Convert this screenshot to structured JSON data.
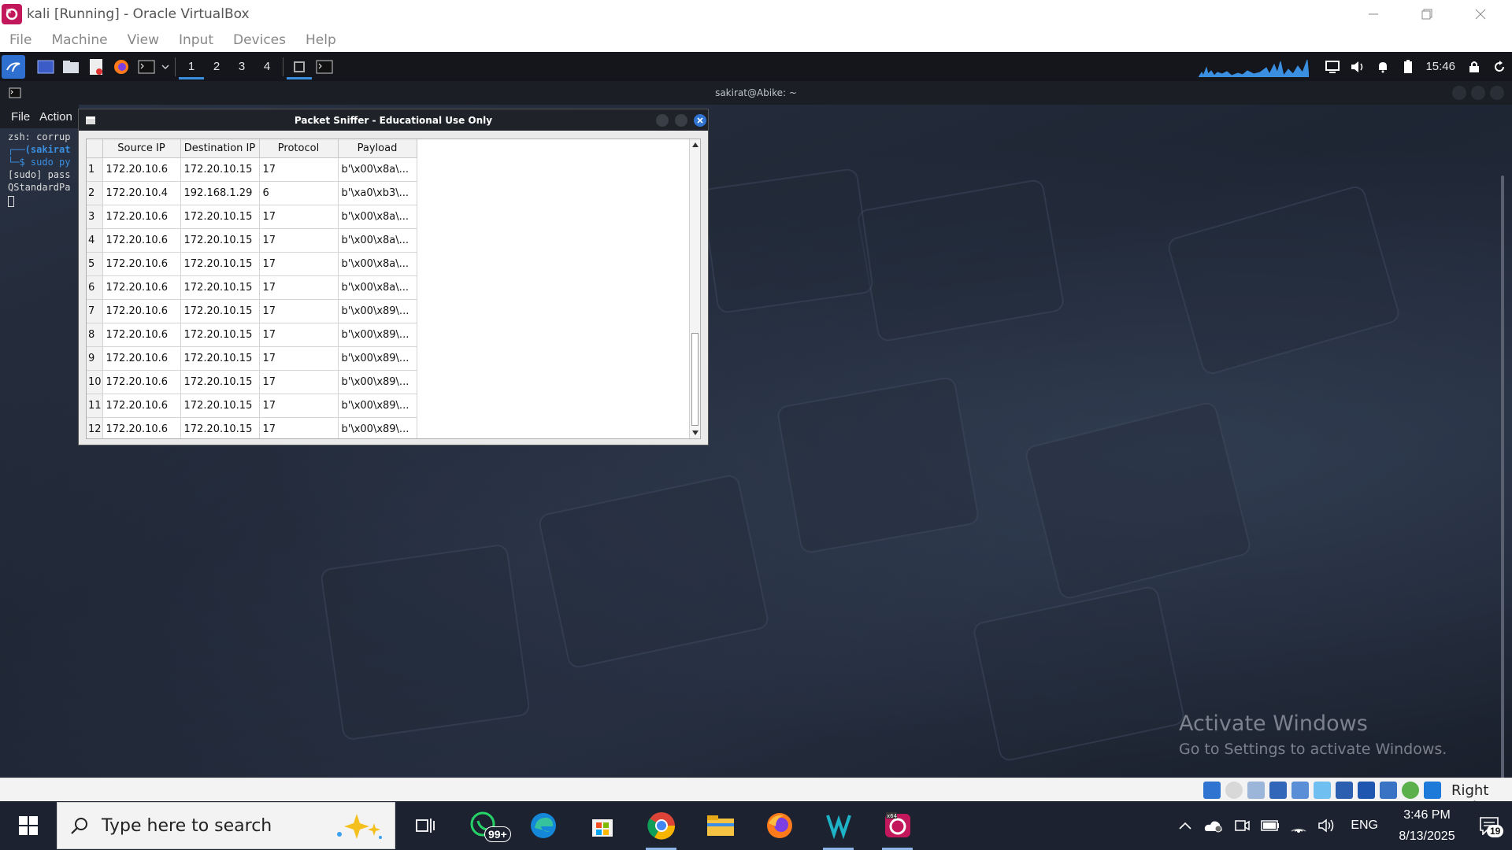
{
  "host_window": {
    "title": "kali [Running] - Oracle VirtualBox",
    "menu": [
      "File",
      "Machine",
      "View",
      "Input",
      "Devices",
      "Help"
    ]
  },
  "kali_panel": {
    "workspaces": [
      "1",
      "2",
      "3",
      "4"
    ],
    "active_workspace": "1",
    "clock": "15:46"
  },
  "terminal": {
    "title": "sakirat@Abike: ~",
    "menu": [
      "File",
      "Action"
    ],
    "lines": [
      "zsh: corrup",
      "┌──(sakirat",
      "└─$ sudo py",
      "[sudo] pass",
      "QStandardPa"
    ]
  },
  "sniffer": {
    "title": "Packet Sniffer - Educational Use Only",
    "columns": [
      "Source IP",
      "Destination IP",
      "Protocol",
      "Payload"
    ],
    "rows": [
      {
        "n": "1",
        "src": "172.20.10.6",
        "dst": "172.20.10.15",
        "proto": "17",
        "payload": "b'\\x00\\x8a\\..."
      },
      {
        "n": "2",
        "src": "172.20.10.4",
        "dst": "192.168.1.29",
        "proto": "6",
        "payload": "b'\\xa0\\xb3\\..."
      },
      {
        "n": "3",
        "src": "172.20.10.6",
        "dst": "172.20.10.15",
        "proto": "17",
        "payload": "b'\\x00\\x8a\\..."
      },
      {
        "n": "4",
        "src": "172.20.10.6",
        "dst": "172.20.10.15",
        "proto": "17",
        "payload": "b'\\x00\\x8a\\..."
      },
      {
        "n": "5",
        "src": "172.20.10.6",
        "dst": "172.20.10.15",
        "proto": "17",
        "payload": "b'\\x00\\x8a\\..."
      },
      {
        "n": "6",
        "src": "172.20.10.6",
        "dst": "172.20.10.15",
        "proto": "17",
        "payload": "b'\\x00\\x8a\\..."
      },
      {
        "n": "7",
        "src": "172.20.10.6",
        "dst": "172.20.10.15",
        "proto": "17",
        "payload": "b'\\x00\\x89\\..."
      },
      {
        "n": "8",
        "src": "172.20.10.6",
        "dst": "172.20.10.15",
        "proto": "17",
        "payload": "b'\\x00\\x89\\..."
      },
      {
        "n": "9",
        "src": "172.20.10.6",
        "dst": "172.20.10.15",
        "proto": "17",
        "payload": "b'\\x00\\x89\\..."
      },
      {
        "n": "10",
        "src": "172.20.10.6",
        "dst": "172.20.10.15",
        "proto": "17",
        "payload": "b'\\x00\\x89\\..."
      },
      {
        "n": "11",
        "src": "172.20.10.6",
        "dst": "172.20.10.15",
        "proto": "17",
        "payload": "b'\\x00\\x89\\..."
      },
      {
        "n": "12",
        "src": "172.20.10.6",
        "dst": "172.20.10.15",
        "proto": "17",
        "payload": "b'\\x00\\x89\\..."
      }
    ]
  },
  "watermark": {
    "title": "Activate Windows",
    "subtitle": "Go to Settings to activate Windows."
  },
  "vb_status": {
    "host_key": "Right Ctrl"
  },
  "taskbar": {
    "search_placeholder": "Type here to search",
    "whatsapp_badge": "99+",
    "language": "ENG",
    "time": "3:46 PM",
    "date": "8/13/2025",
    "notification_count": "19"
  },
  "colors": {
    "kali_accent": "#3b8fe0",
    "guest_bg": "#1e2533",
    "taskbar_bg": "#1c2230"
  }
}
